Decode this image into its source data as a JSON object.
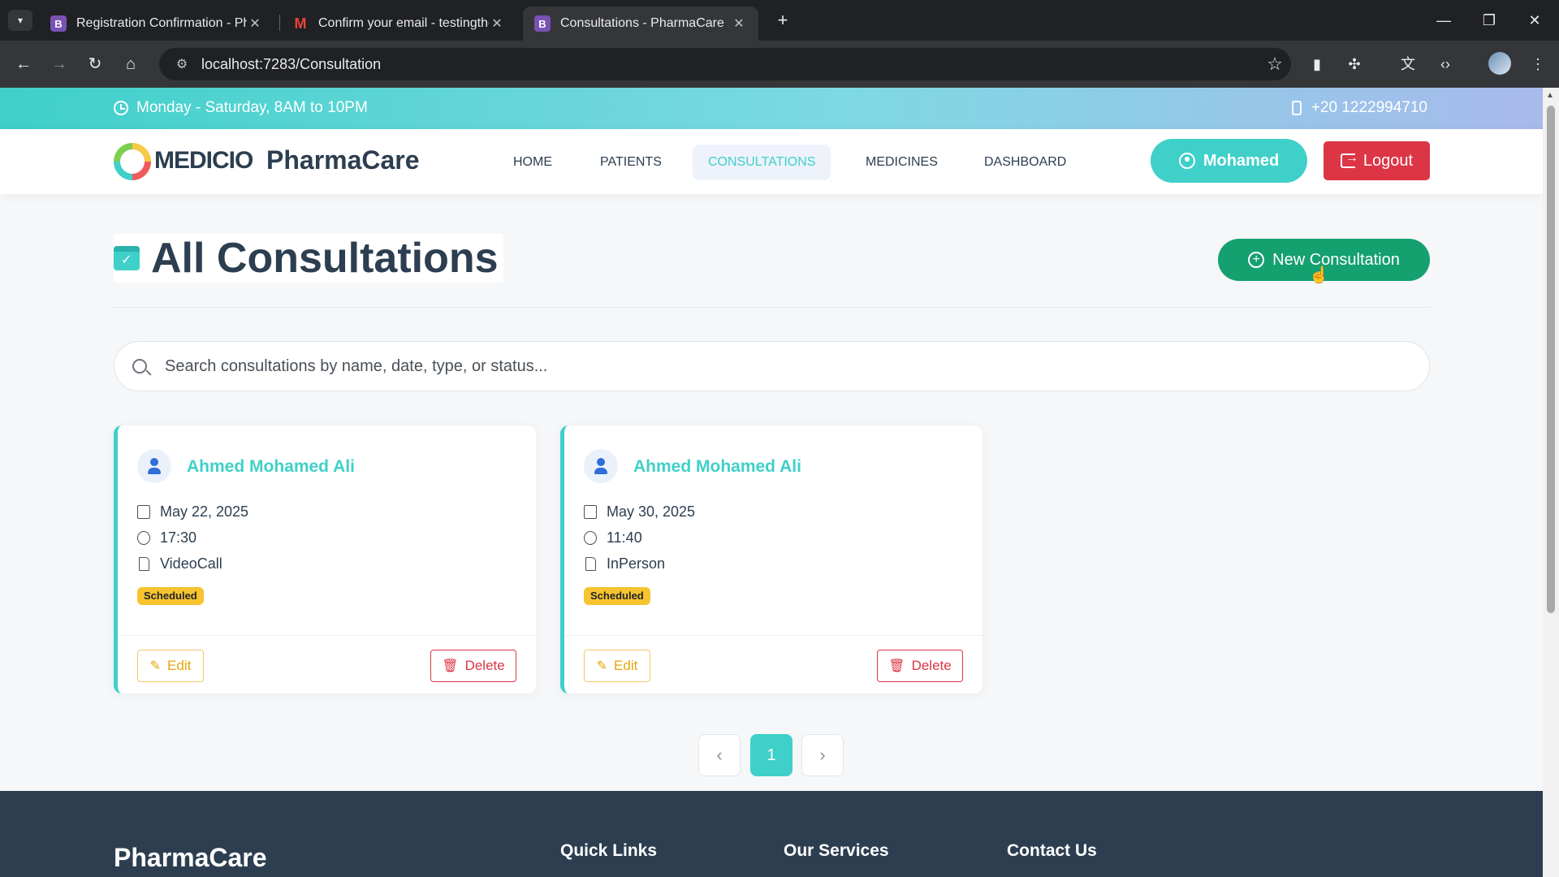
{
  "browser": {
    "tabs": [
      {
        "title": "Registration Confirmation - PharmaCare",
        "favicon": "B"
      },
      {
        "title": "Confirm your email - testingthe",
        "favicon": "M"
      },
      {
        "title": "Consultations - PharmaCare",
        "favicon": "B"
      }
    ],
    "url": "localhost:7283/Consultation"
  },
  "topbar": {
    "hours": "Monday - Saturday, 8AM to 10PM",
    "phone": "+20 1222994710"
  },
  "header": {
    "logo": "MEDICIO",
    "brand": "PharmaCare",
    "nav": [
      "HOME",
      "PATIENTS",
      "CONSULTATIONS",
      "MEDICINES",
      "DASHBOARD"
    ],
    "user": "Mohamed",
    "logout": "Logout"
  },
  "page": {
    "title": "All Consultations",
    "new_button": "New Consultation",
    "search_placeholder": "Search consultations by name, date, type, or status..."
  },
  "cards": [
    {
      "name": "Ahmed Mohamed Ali",
      "date": "May 22, 2025",
      "time": "17:30",
      "type": "VideoCall",
      "status": "Scheduled",
      "edit": "Edit",
      "delete": "Delete"
    },
    {
      "name": "Ahmed Mohamed Ali",
      "date": "May 30, 2025",
      "time": "11:40",
      "type": "InPerson",
      "status": "Scheduled",
      "edit": "Edit",
      "delete": "Delete"
    }
  ],
  "pagination": {
    "current": "1"
  },
  "footer": {
    "brand": "PharmaCare",
    "headings": [
      "Quick Links",
      "Our Services",
      "Contact Us"
    ]
  },
  "colors": {
    "accent": "#3fd0c9",
    "success": "#15a070",
    "danger": "#dc3545",
    "warning": "#f7c32e",
    "footer": "#2c3e50"
  }
}
